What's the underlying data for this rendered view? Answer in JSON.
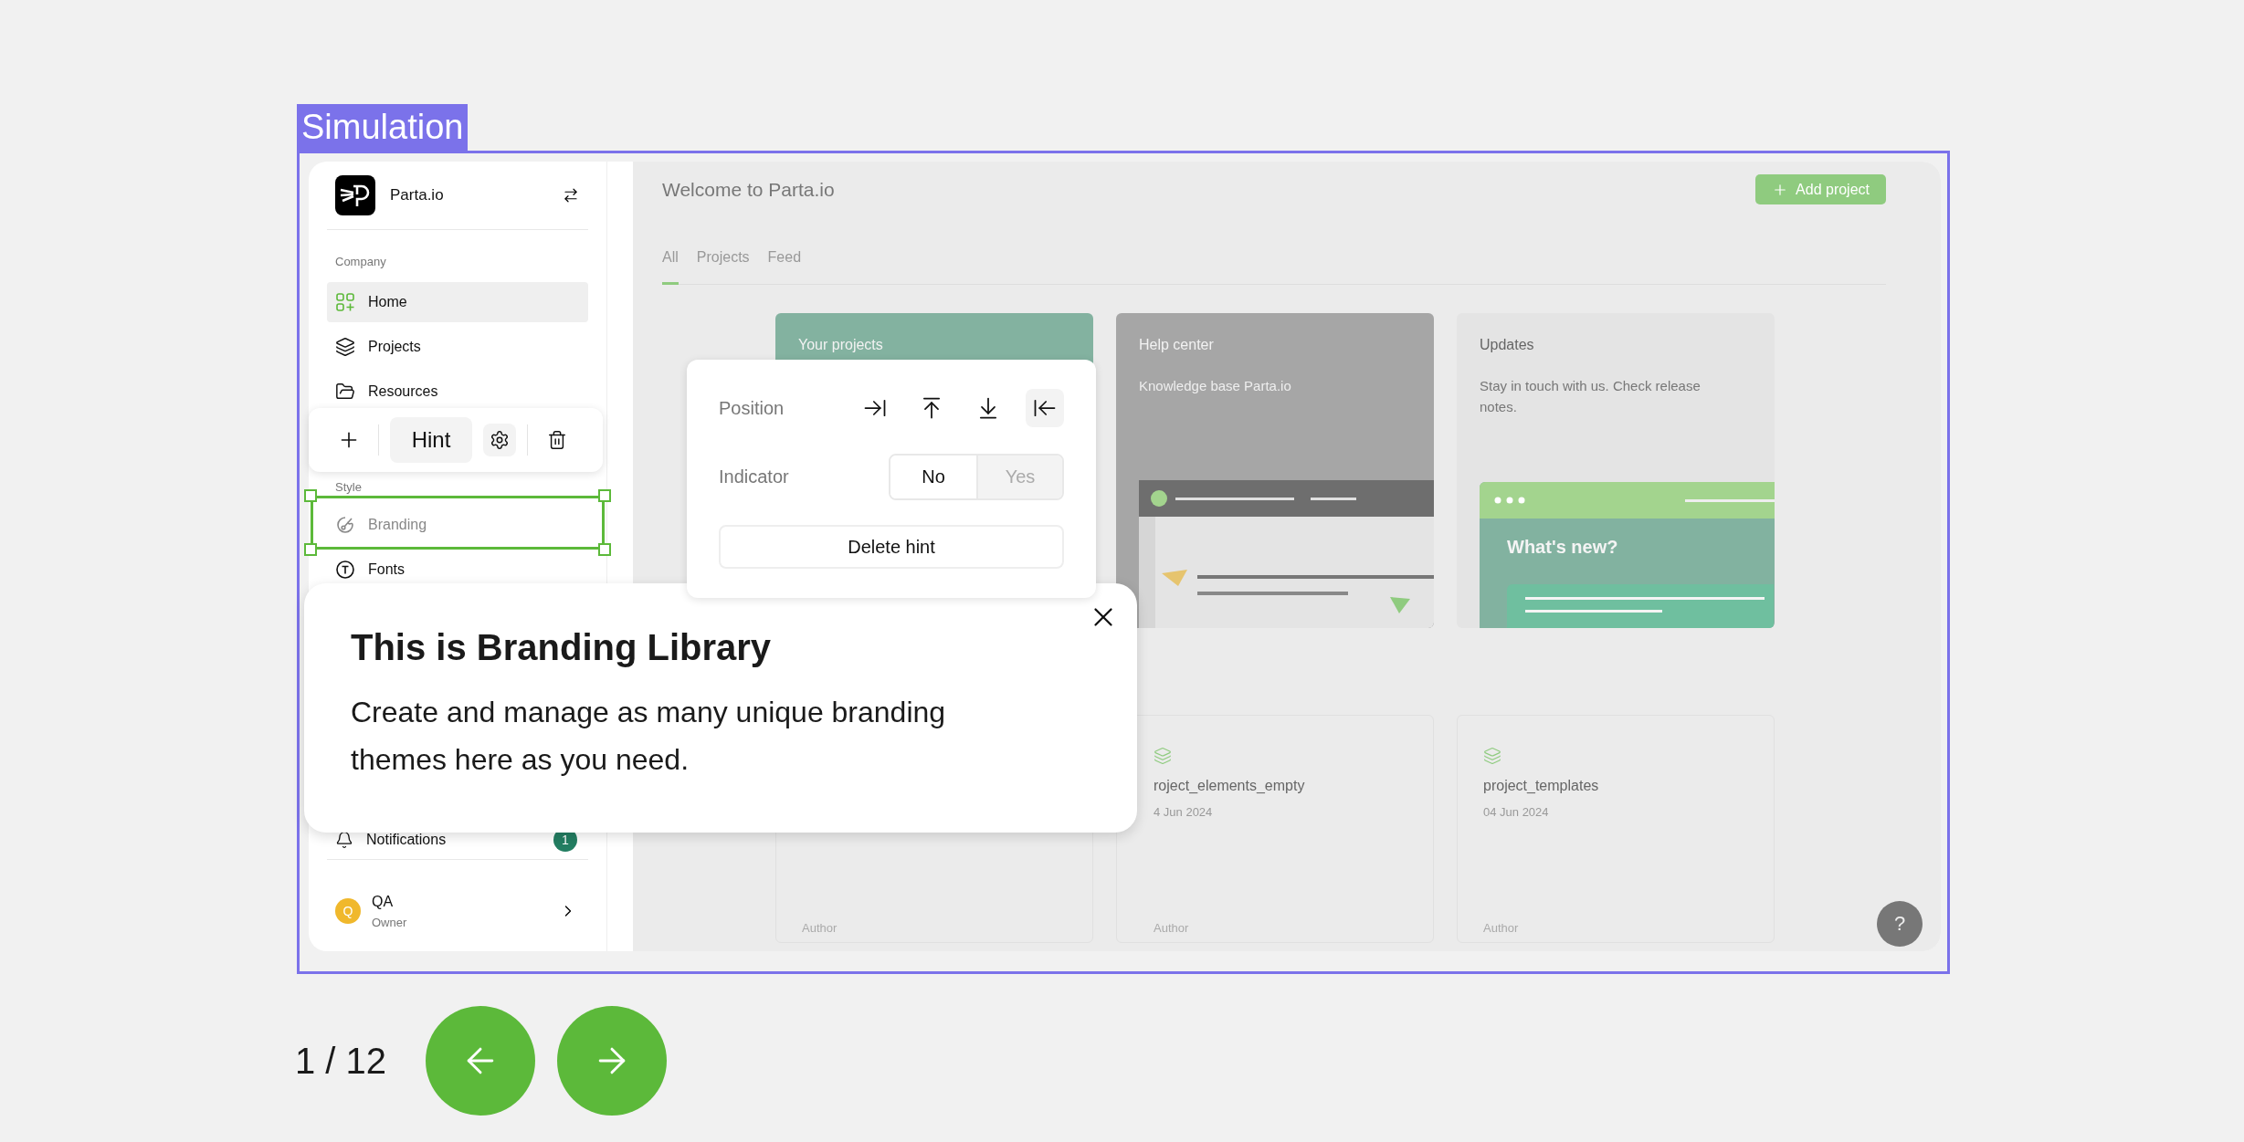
{
  "label": "Simulation",
  "sidebar": {
    "brand": "Parta.io",
    "sections": [
      {
        "title": "Company",
        "items": [
          {
            "label": "Home",
            "kind": "grid",
            "selected": true,
            "hint_target": false
          },
          {
            "label": "Projects",
            "kind": "layers",
            "selected": false,
            "hint_target": false
          },
          {
            "label": "Resources",
            "kind": "folder",
            "selected": false,
            "hint_target": false
          }
        ]
      },
      {
        "title": "Style",
        "items": [
          {
            "label": "Branding",
            "kind": "palette",
            "selected": false,
            "hint_target": true
          },
          {
            "label": "Fonts",
            "kind": "type",
            "selected": false,
            "hint_target": false
          }
        ]
      }
    ],
    "notifications": {
      "label": "Notifications",
      "count": "1"
    },
    "user": {
      "initial": "Q",
      "name": "QA",
      "role": "Owner"
    }
  },
  "main": {
    "title": "Welcome to Parta.io",
    "add_button": "Add project",
    "tabs": [
      {
        "label": "All",
        "selected": true
      },
      {
        "label": "Projects",
        "selected": false
      },
      {
        "label": "Feed",
        "selected": false
      }
    ],
    "feature_cards": [
      {
        "kind": "projects",
        "title": "Your projects"
      },
      {
        "kind": "help",
        "title": "Help center",
        "text": "Knowledge base Parta.io"
      },
      {
        "kind": "updates",
        "title": "Updates",
        "text": "Stay in touch with us. Check release notes.",
        "banner": "What's new?"
      }
    ],
    "project_cards": [
      {
        "author": "Author"
      },
      {
        "name": "roject_elements_empty",
        "date": "4 Jun 2024",
        "author": "Author"
      },
      {
        "name": "project_templates",
        "date": "04 Jun 2024",
        "author": "Author"
      }
    ],
    "help": "?"
  },
  "hint_toolbar": {
    "label": "Hint"
  },
  "hint_settings": {
    "position": {
      "label": "Position",
      "options": [
        {
          "kind": "right",
          "selected": false
        },
        {
          "kind": "top",
          "selected": false
        },
        {
          "kind": "bottom",
          "selected": false
        },
        {
          "kind": "left",
          "selected": true
        }
      ]
    },
    "indicator": {
      "label": "Indicator",
      "options": [
        {
          "label": "No",
          "selected": true
        },
        {
          "label": "Yes",
          "selected": false
        }
      ]
    },
    "delete": "Delete hint"
  },
  "tooltip": {
    "title": "This is Branding Library",
    "body": "Create and manage as many unique branding themes here as you need."
  },
  "pager": {
    "counter": "1 / 12"
  }
}
